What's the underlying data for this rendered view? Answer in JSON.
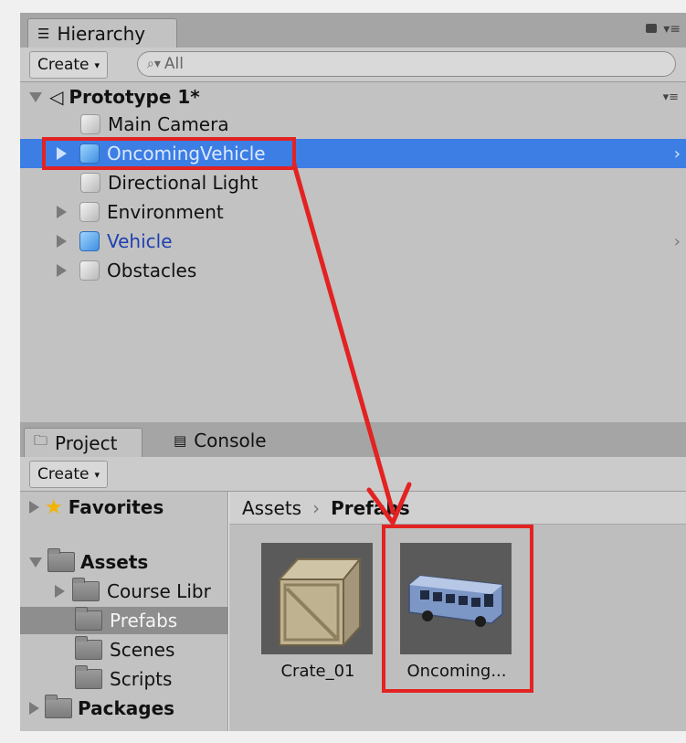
{
  "hierarchy": {
    "tab_label": "Hierarchy",
    "create_label": "Create",
    "search_placeholder": "All",
    "scene_name": "Prototype 1*",
    "items": [
      {
        "label": "Main Camera"
      },
      {
        "label": "OncomingVehicle"
      },
      {
        "label": "Directional Light"
      },
      {
        "label": "Environment"
      },
      {
        "label": "Vehicle"
      },
      {
        "label": "Obstacles"
      }
    ]
  },
  "project": {
    "tab_project": "Project",
    "tab_console": "Console",
    "create_label": "Create",
    "tree": {
      "favorites": "Favorites",
      "assets": "Assets",
      "course_library": "Course Libr",
      "prefabs": "Prefabs",
      "scenes": "Scenes",
      "scripts": "Scripts",
      "packages": "Packages"
    },
    "breadcrumb": {
      "root": "Assets",
      "current": "Prefabs"
    },
    "grid": [
      {
        "label": "Crate_01"
      },
      {
        "label": "Oncoming..."
      }
    ]
  },
  "colors": {
    "selection": "#3d7ee5",
    "annotation": "#e32222",
    "prefab_text": "#1f3fb0"
  }
}
